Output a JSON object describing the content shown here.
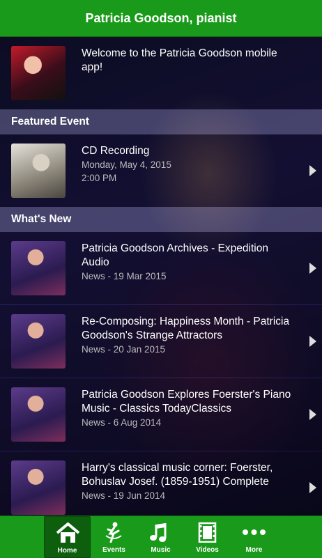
{
  "header": {
    "title": "Patricia Goodson, pianist"
  },
  "welcome": {
    "text": "Welcome to the Patricia Goodson mobile app!"
  },
  "featured": {
    "heading": "Featured Event",
    "title": "CD Recording",
    "date": "Monday, May 4, 2015",
    "time": "2:00 PM"
  },
  "whatsnew": {
    "heading": "What's New",
    "items": [
      {
        "title": "Patricia Goodson Archives - Expedition Audio",
        "meta": "News - 19 Mar 2015"
      },
      {
        "title": "Re-Composing: Happiness Month - Patricia Goodson's Strange Attractors",
        "meta": "News - 20 Jan 2015"
      },
      {
        "title": "Patricia Goodson Explores Foerster's Piano Music - Classics TodayClassics",
        "meta": "News - 6 Aug 2014"
      },
      {
        "title": "Harry's classical music corner: Foerster, Bohuslav Josef. (1859-1951) Complete",
        "meta": "News - 19 Jun 2014"
      }
    ]
  },
  "tabbar": {
    "tabs": [
      {
        "label": "Home",
        "icon": "home-icon"
      },
      {
        "label": "Events",
        "icon": "events-icon"
      },
      {
        "label": "Music",
        "icon": "music-icon"
      },
      {
        "label": "Videos",
        "icon": "videos-icon"
      },
      {
        "label": "More",
        "icon": "more-icon"
      }
    ]
  },
  "colors": {
    "brand_green": "#1a9a1a",
    "active_tab": "#0d5e0d"
  }
}
